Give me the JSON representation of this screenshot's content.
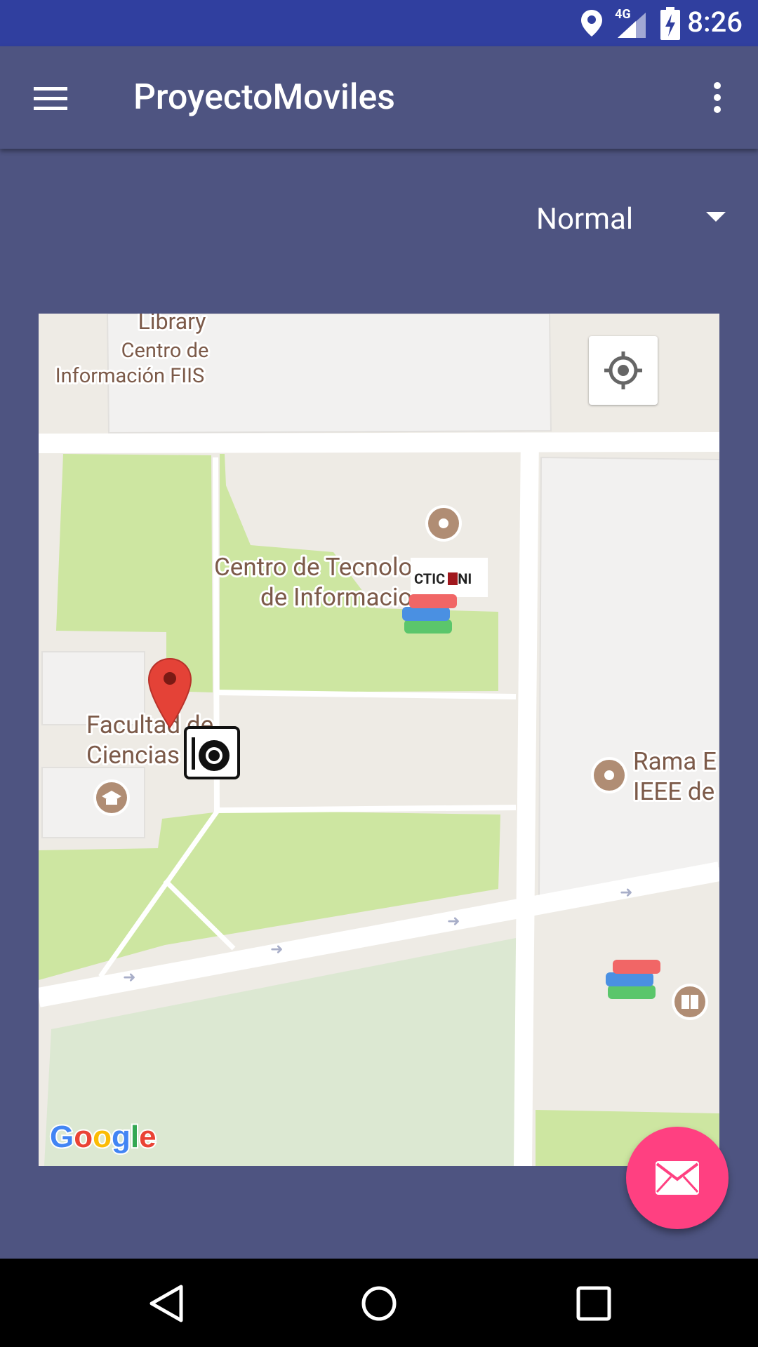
{
  "status_bar": {
    "time": "8:26",
    "network": "4G",
    "icons": [
      "location-icon",
      "signal-icon",
      "battery-charging-icon"
    ]
  },
  "app_bar": {
    "title": "ProyectoMoviles",
    "menu_icon": "hamburger-menu-icon",
    "overflow_icon": "more-vert-icon"
  },
  "map_type_spinner": {
    "selected": "Normal"
  },
  "map": {
    "labels": {
      "library": "Library",
      "cdi_line1": "Centro de",
      "cdi_line2": "Información FIIS",
      "ctic_line1": "Centro de Tecnolo",
      "ctic_line2": "de Informacion...",
      "ctic_logo": "CTIC UNI",
      "facultad_line1": "Facultad de",
      "facultad_line2": "Ciencias",
      "ieee_line1": "Rama E",
      "ieee_line2": "IEEE de",
      "google": "Google"
    },
    "colors": {
      "background": "#EEEBE5",
      "park": "#CDE6A1",
      "park_light": "#DCE8D2",
      "building": "#F2F1F0",
      "road": "#FFFFFF",
      "label": "#7C5A49",
      "poi": "#B08D74",
      "marker": "#E44237"
    }
  },
  "fab": {
    "icon": "email-icon",
    "color": "#FF4081"
  },
  "nav_bar": {
    "icons": [
      "back-icon",
      "home-icon",
      "recents-icon"
    ]
  }
}
